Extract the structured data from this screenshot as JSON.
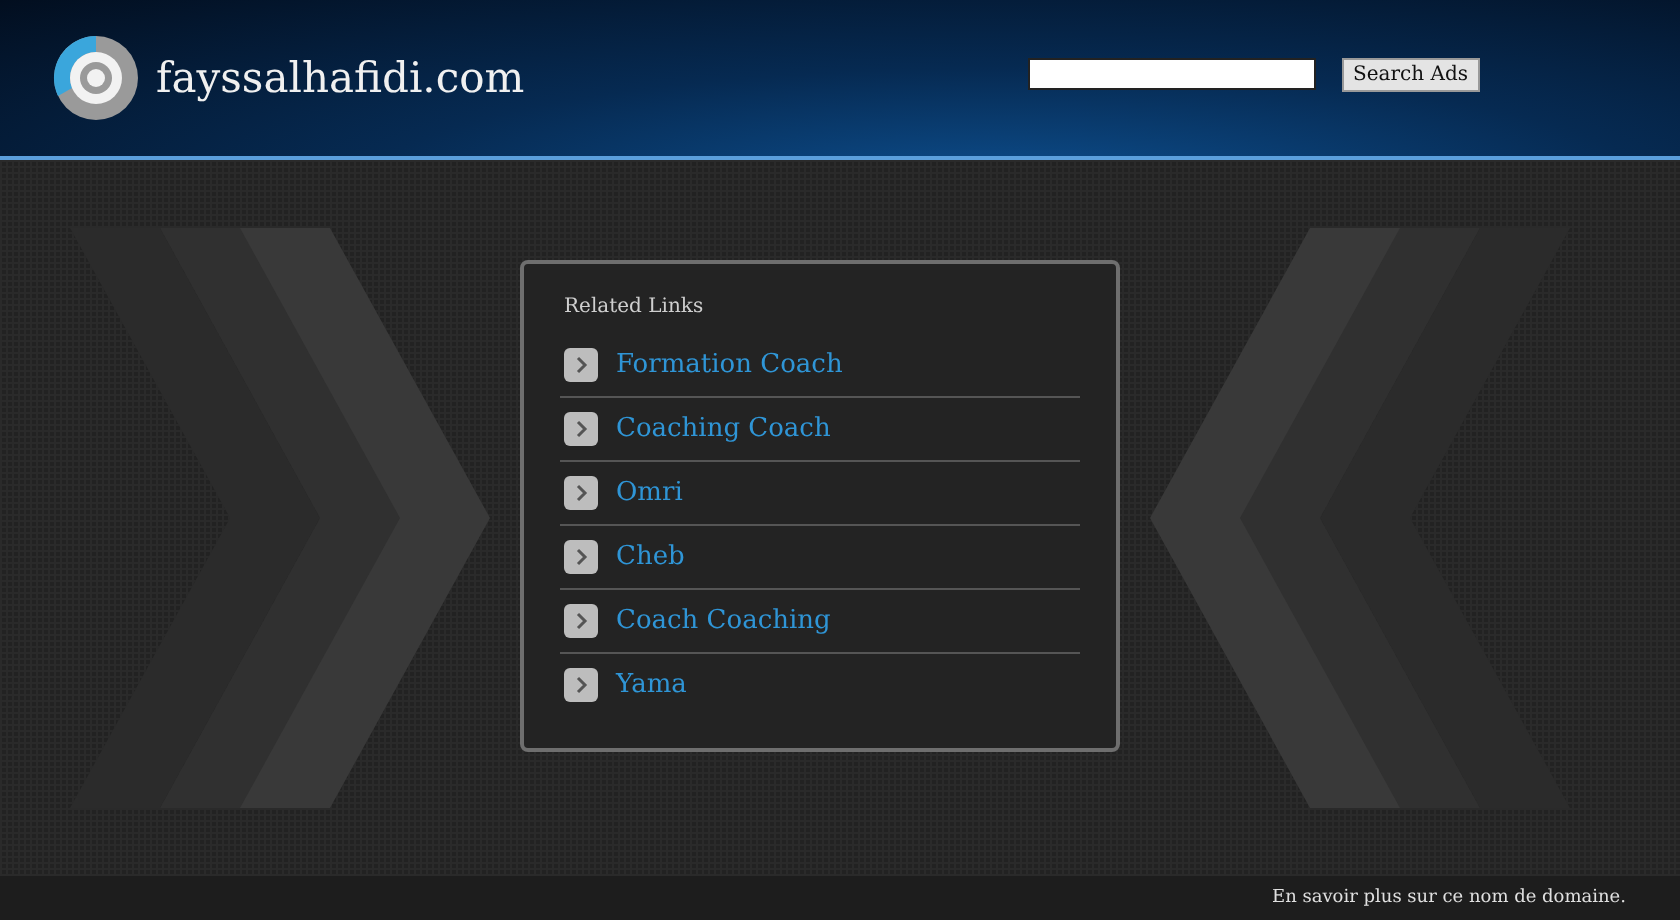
{
  "header": {
    "site_name": "fayssalhafidi.com",
    "search": {
      "button": "Search Ads"
    }
  },
  "related_links": {
    "title": "Related Links",
    "items": [
      {
        "label": "Formation Coach"
      },
      {
        "label": "Coaching Coach"
      },
      {
        "label": "Omri"
      },
      {
        "label": "Cheb"
      },
      {
        "label": "Coach Coaching"
      },
      {
        "label": "Yama"
      }
    ]
  },
  "footer": {
    "link": "En savoir plus sur ce nom de domaine."
  }
}
